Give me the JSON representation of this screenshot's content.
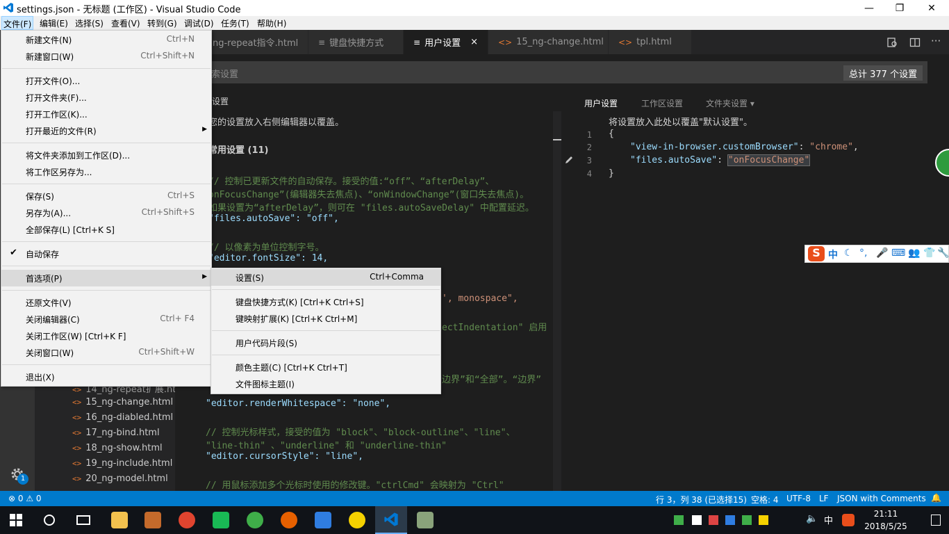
{
  "window": {
    "title": "settings.json - 无标题 (工作区) - Visual Studio Code",
    "controls": [
      "—",
      "❐",
      "✕"
    ]
  },
  "menubar": [
    "文件(F)",
    "编辑(E)",
    "选择(S)",
    "查看(V)",
    "转到(G)",
    "调试(D)",
    "任务(T)",
    "帮助(H)"
  ],
  "tabs": [
    {
      "label": "ng-repeat指令.html",
      "icon": "<>"
    },
    {
      "label": "键盘快捷方式",
      "icon": "≡"
    },
    {
      "label": "用户设置",
      "icon": "≡",
      "close": "×"
    },
    {
      "label": "15_ng-change.html",
      "icon": "<>"
    },
    {
      "label": "tpl.html",
      "icon": "<>"
    }
  ],
  "search": {
    "placeholder": "索设置",
    "count": "总计 377 个设置"
  },
  "left_pane": {
    "header": "设置",
    "intro": "您的设置放入右侧编辑器以覆盖。",
    "section": "常用设置 (11)",
    "lines": [
      "// 控制已更新文件的自动保存。接受的值:“off”、“afterDelay”、",
      "onFocusChange”(编辑器失去焦点)、“onWindowChange”(窗口失去焦点)。",
      "如果设置为“afterDelay”，则可在 \"files.autoSaveDelay\" 中配置延迟。",
      "\"files.autoSave\": \"off\",",
      "// 以像素为单位控制字号。",
      "\"editor.fontSize\": 14,",
      "', monospace\",",
      "ectIndentation\" 启用",
      "边界”和“全部”。“边界”",
      "\"editor.renderWhitespace\": \"none\",",
      "// 控制光标样式，接受的值为 \"block\"、\"block-outline\"、\"line\"、",
      "\"line-thin\" 、\"underline\" 和 \"underline-thin\"",
      "\"editor.cursorStyle\": \"line\",",
      "// 用鼠标添加多个光标时使用的修改键。\"ctrlCmd\" 会映射为 \"Ctrl\""
    ]
  },
  "right_pane": {
    "tabs": [
      "用户设置",
      "工作区设置",
      "文件夹设置 ▾"
    ],
    "hint": "将设置放入此处以覆盖\"默认设置\"。",
    "lines": [
      "{",
      "\"view-in-browser.customBrowser\": \"chrome\",",
      "\"files.autoSave\": \"onFocusChange\"",
      "}"
    ],
    "line_numbers": [
      "1",
      "2",
      "3",
      "4"
    ],
    "key1": "\"view-in-browser.customBrowser\"",
    "val1": "\"chrome\"",
    "key2": "\"files.autoSave\"",
    "val2": "\"onFocusChange\""
  },
  "sidebar_files": [
    "14_ng-repeat扩展.ht...",
    "15_ng-change.html",
    "16_ng-diabled.html",
    "17_ng-bind.html",
    "18_ng-show.html",
    "19_ng-include.html",
    "20_ng-model.html"
  ],
  "file_menu": [
    {
      "label": "新建文件(N)",
      "shortcut": "Ctrl+N"
    },
    {
      "label": "新建窗口(W)",
      "shortcut": "Ctrl+Shift+N"
    },
    {
      "label": "打开文件(O)...",
      "shortcut": ""
    },
    {
      "label": "打开文件夹(F)...",
      "shortcut": ""
    },
    {
      "label": "打开工作区(K)...",
      "shortcut": ""
    },
    {
      "label": "打开最近的文件(R)",
      "shortcut": ""
    },
    {
      "label": "将文件夹添加到工作区(D)...",
      "shortcut": ""
    },
    {
      "label": "将工作区另存为...",
      "shortcut": ""
    },
    {
      "label": "保存(S)",
      "shortcut": "Ctrl+S"
    },
    {
      "label": "另存为(A)...",
      "shortcut": "Ctrl+Shift+S"
    },
    {
      "label": "全部保存(L) [Ctrl+K S]",
      "shortcut": ""
    },
    {
      "label": "自动保存",
      "shortcut": ""
    },
    {
      "label": "首选项(P)",
      "shortcut": ""
    },
    {
      "label": "还原文件(V)",
      "shortcut": ""
    },
    {
      "label": "关闭编辑器(C)",
      "shortcut": "Ctrl+ F4"
    },
    {
      "label": "关闭工作区(W) [Ctrl+K F]",
      "shortcut": ""
    },
    {
      "label": "关闭窗口(W)",
      "shortcut": "Ctrl+Shift+W"
    },
    {
      "label": "退出(X)",
      "shortcut": ""
    }
  ],
  "prefs_menu": [
    {
      "label": "设置(S)",
      "shortcut": "Ctrl+Comma"
    },
    {
      "label": "键盘快捷方式(K) [Ctrl+K Ctrl+S]",
      "shortcut": ""
    },
    {
      "label": "键映射扩展(K) [Ctrl+K Ctrl+M]",
      "shortcut": ""
    },
    {
      "label": "用户代码片段(S)",
      "shortcut": ""
    },
    {
      "label": "颜色主题(C) [Ctrl+K Ctrl+T]",
      "shortcut": ""
    },
    {
      "label": "文件图标主题(I)",
      "shortcut": ""
    }
  ],
  "statusbar": {
    "problems": "⊗ 0 ⚠ 0",
    "position": "行 3，列 38 (已选择15)",
    "spaces": "空格: 4",
    "encoding": "UTF-8",
    "eol": "LF",
    "language": "JSON with Comments",
    "bell": "🔔"
  },
  "taskbar": {
    "time": "21:11",
    "date": "2018/5/25",
    "ime_lang": "中"
  },
  "ime_toolbar": {
    "logo": "S",
    "lang": "中"
  },
  "gear_badge": "1",
  "colors": {
    "accent": "#007acc",
    "titlebar": "#ffffff",
    "editor_bg": "#1e1e1e"
  }
}
